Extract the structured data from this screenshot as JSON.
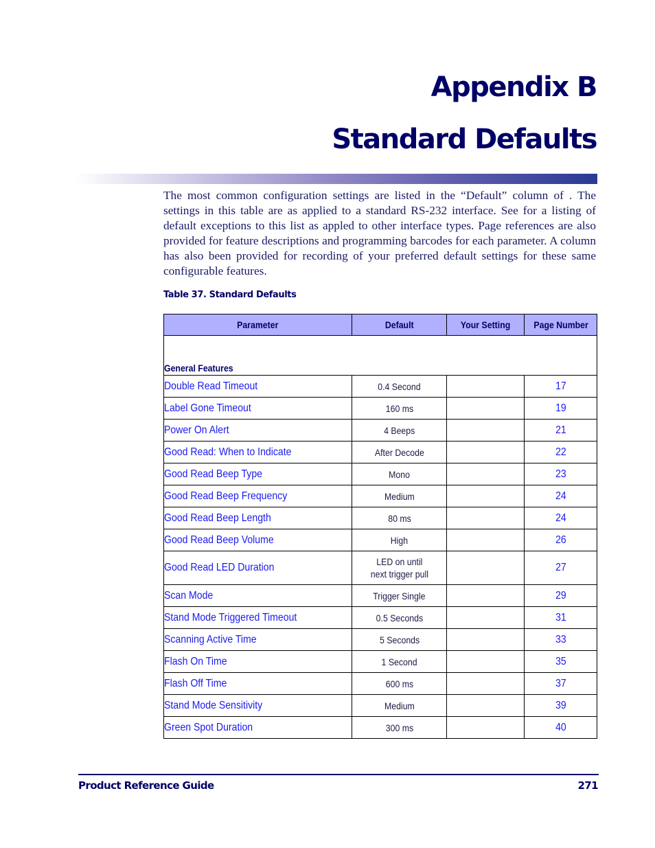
{
  "header": {
    "appendix_label": "Appendix B",
    "chapter_title": "Standard Defaults",
    "accent_color": "#000066",
    "rule_gradient_end": "#2a3a94"
  },
  "intro_text": "The most common configuration settings are listed in the “Default” column of            . The settings in this table are as applied to a standard RS-232 interface. See              for a listing of default exceptions to this list as appled to other interface types. Page references are also provided for feature descriptions and programming barcodes for each parameter. A column has also been provided for recording of your preferred default settings for these same configurable features.",
  "table": {
    "caption": "Table 37. Standard Defaults",
    "header_bg": "#b0b0ff",
    "columns": [
      "Parameter",
      "Default",
      "Your Setting",
      "Page Number"
    ],
    "section": "General Features",
    "rows": [
      {
        "parameter": "Double Read Timeout",
        "default": "0.4 Second",
        "your_setting": "",
        "page": "17"
      },
      {
        "parameter": "Label Gone Timeout",
        "default": "160 ms",
        "your_setting": "",
        "page": "19"
      },
      {
        "parameter": "Power On Alert",
        "default": "4 Beeps",
        "your_setting": "",
        "page": "21"
      },
      {
        "parameter": "Good Read: When to Indicate",
        "default": "After Decode",
        "your_setting": "",
        "page": "22"
      },
      {
        "parameter": "Good Read Beep Type",
        "default": "Mono",
        "your_setting": "",
        "page": "23"
      },
      {
        "parameter": "Good Read Beep Frequency",
        "default": "Medium",
        "your_setting": "",
        "page": "24"
      },
      {
        "parameter": "Good Read Beep Length",
        "default": "80 ms",
        "your_setting": "",
        "page": "24"
      },
      {
        "parameter": "Good Read Beep Volume",
        "default": "High",
        "your_setting": "",
        "page": "26"
      },
      {
        "parameter": "Good Read LED Duration",
        "default": "LED on until\nnext trigger pull",
        "your_setting": "",
        "page": "27"
      },
      {
        "parameter": "Scan Mode",
        "default": "Trigger Single",
        "your_setting": "",
        "page": "29"
      },
      {
        "parameter": "Stand Mode Triggered Timeout",
        "default": "0.5 Seconds",
        "your_setting": "",
        "page": "31"
      },
      {
        "parameter": "Scanning Active Time",
        "default": "5 Seconds",
        "your_setting": "",
        "page": "33"
      },
      {
        "parameter": "Flash On Time",
        "default": "1 Second",
        "your_setting": "",
        "page": "35"
      },
      {
        "parameter": "Flash Off Time",
        "default": "600 ms",
        "your_setting": "",
        "page": "37"
      },
      {
        "parameter": "Stand Mode Sensitivity",
        "default": "Medium",
        "your_setting": "",
        "page": "39"
      },
      {
        "parameter": "Green Spot Duration",
        "default": "300 ms",
        "your_setting": "",
        "page": "40"
      }
    ]
  },
  "footer": {
    "guide_title": "Product Reference Guide",
    "page_number": "271"
  }
}
